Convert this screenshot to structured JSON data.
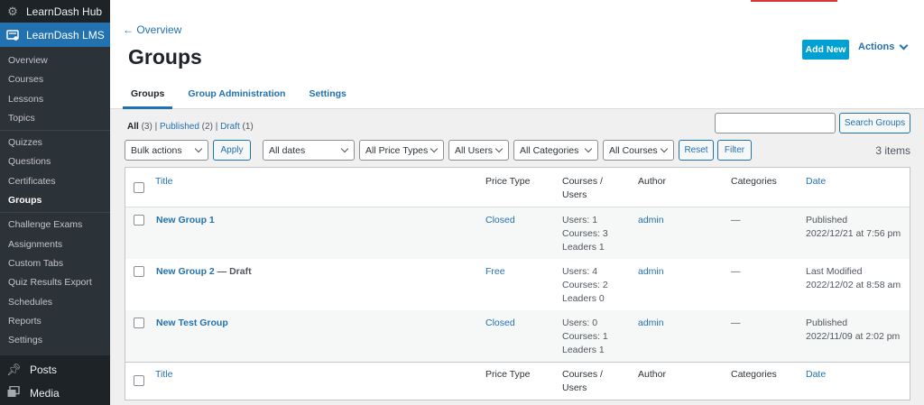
{
  "sidebar": {
    "hub_label": "LearnDash Hub",
    "active_label": "LearnDash LMS",
    "items": [
      "Overview",
      "Courses",
      "Lessons",
      "Topics"
    ],
    "items2": [
      "Quizzes",
      "Questions",
      "Certificates",
      "Groups"
    ],
    "items3": [
      "Challenge Exams",
      "Assignments",
      "Custom Tabs",
      "Quiz Results Export",
      "Schedules",
      "Reports",
      "Settings"
    ],
    "posts_label": "Posts",
    "media_label": "Media"
  },
  "header": {
    "back_link": "← Overview",
    "title": "Groups",
    "add_new": "Add New",
    "actions": "Actions",
    "tabs": [
      "Groups",
      "Group Administration",
      "Settings"
    ]
  },
  "filters": {
    "all": "All",
    "all_count": "(3)",
    "published": "Published",
    "published_count": "(2)",
    "draft": "Draft",
    "draft_count": "(1)",
    "search_button": "Search Groups",
    "bulk_actions": "Bulk actions",
    "apply": "Apply",
    "all_dates": "All dates",
    "all_price_types": "All Price Types",
    "all_users": "All Users",
    "all_categories": "All Categories",
    "all_courses": "All Courses",
    "reset": "Reset",
    "filter": "Filter",
    "items_count": "3 items"
  },
  "table": {
    "columns": {
      "title": "Title",
      "price_type": "Price Type",
      "courses_users_1": "Courses /",
      "courses_users_2": "Users",
      "author": "Author",
      "categories": "Categories",
      "date": "Date"
    },
    "rows": [
      {
        "title": "New Group 1",
        "state": "",
        "price_type": "Closed",
        "users": "Users: 1",
        "courses": "Courses: 3",
        "leaders": "Leaders 1",
        "author": "admin",
        "categories": "—",
        "date_status": "Published",
        "date_value": "2022/12/21 at 7:56 pm"
      },
      {
        "title": "New Group 2",
        "state": " — Draft",
        "price_type": "Free",
        "users": "Users: 4",
        "courses": "Courses: 2",
        "leaders": "Leaders 0",
        "author": "admin",
        "categories": "—",
        "date_status": "Last Modified",
        "date_value": "2022/12/02 at 8:58 am"
      },
      {
        "title": "New Test Group",
        "state": "",
        "price_type": "Closed",
        "users": "Users: 0",
        "courses": "Courses: 1",
        "leaders": "Leaders 1",
        "author": "admin",
        "categories": "—",
        "date_status": "Published",
        "date_value": "2022/11/09 at 2:02 pm"
      }
    ]
  },
  "colors": {
    "sidebar_bg": "#1d2327",
    "accent": "#2271b1",
    "add_new_bg": "#00a0d2"
  }
}
